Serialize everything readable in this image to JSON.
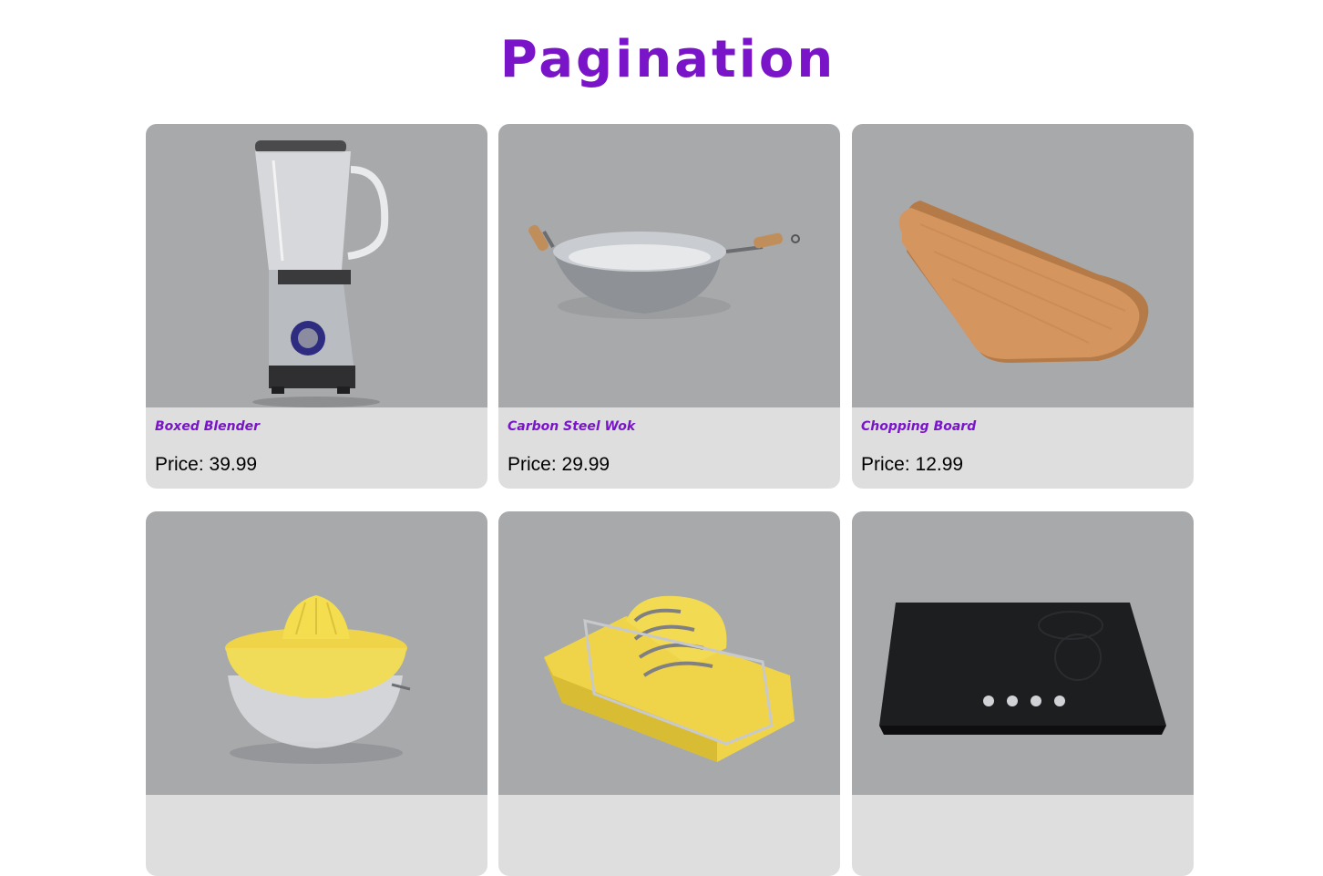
{
  "page": {
    "title": "Pagination"
  },
  "products": [
    {
      "name": "Boxed Blender",
      "price_text": "Price: 39.99",
      "image_icon": "blender-icon"
    },
    {
      "name": "Carbon Steel Wok",
      "price_text": "Price: 29.99",
      "image_icon": "wok-icon"
    },
    {
      "name": "Chopping Board",
      "price_text": "Price: 12.99",
      "image_icon": "chopping-board-icon"
    },
    {
      "name": "",
      "price_text": "",
      "image_icon": "citrus-juicer-icon"
    },
    {
      "name": "",
      "price_text": "",
      "image_icon": "egg-slicer-icon"
    },
    {
      "name": "",
      "price_text": "",
      "image_icon": "induction-cooktop-icon"
    }
  ],
  "colors": {
    "accent": "#7a14c9",
    "card_image_bg": "#a8a9ab",
    "card_info_bg": "#dedede"
  }
}
